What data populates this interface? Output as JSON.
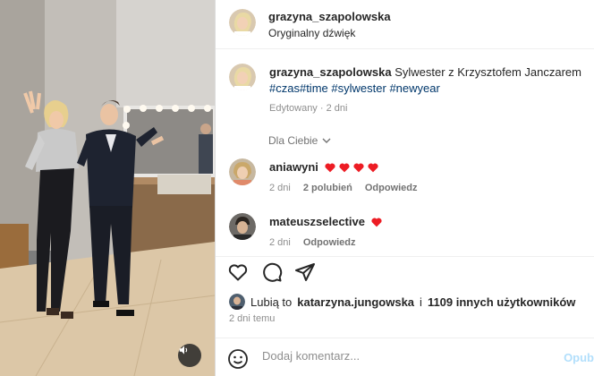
{
  "media": {
    "sound_icon": "speaker-icon"
  },
  "header": {
    "username": "grazyna_szapolowska",
    "audio": "Oryginalny dźwięk"
  },
  "caption": {
    "username": "grazyna_szapolowska",
    "text": "Sylwester z Krzysztofem Janczarem",
    "hashtags": [
      "#czas",
      "#time",
      "#sylwester",
      "#newyear"
    ],
    "meta": "Edytowany · 2 dni"
  },
  "filter": {
    "label": "Dla Ciebie"
  },
  "comments": [
    {
      "username": "aniawyni",
      "text": "❤️❤️❤️❤️",
      "hearts": 4,
      "time": "2 dni",
      "likes": "2 polubień",
      "reply": "Odpowiedz"
    },
    {
      "username": "mateuszselective",
      "text": "❤️",
      "hearts": 1,
      "time": "2 dni",
      "reply": "Odpowiedz"
    }
  ],
  "actions": {
    "like_icon": "heart-icon",
    "comment_icon": "comment-icon",
    "share_icon": "share-icon"
  },
  "likes": {
    "prefix": "Lubią to",
    "user": "katarzyna.jungowska",
    "connector": "i",
    "others": "1109 innych użytkowników"
  },
  "posted": "2 dni temu",
  "comment_box": {
    "placeholder": "Dodaj komentarz...",
    "post_label": "Opub"
  },
  "colors": {
    "link": "#00376b",
    "heart": "#ed1c24",
    "post_disabled": "#b2dffc"
  }
}
